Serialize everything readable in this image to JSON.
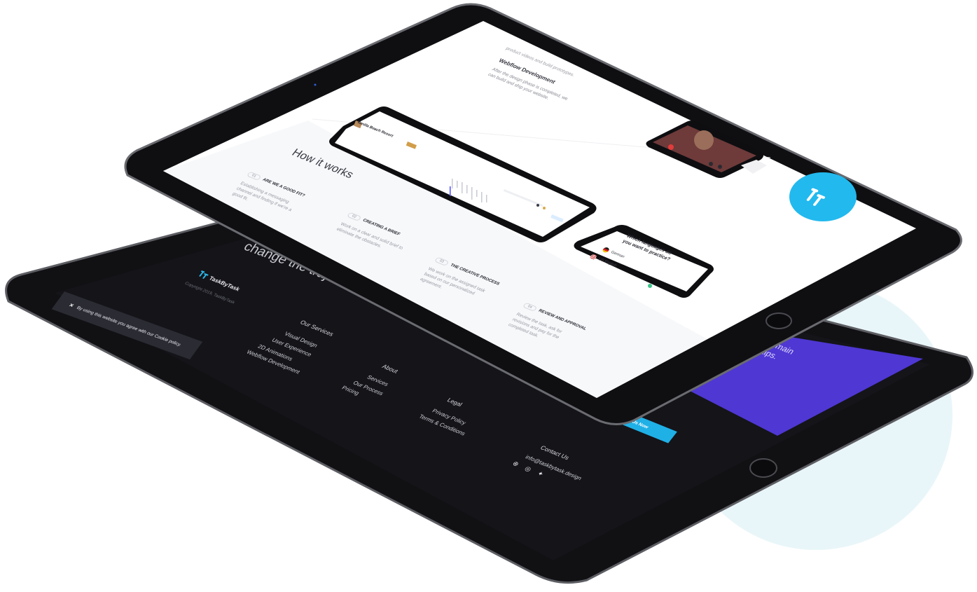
{
  "back": {
    "hero_line": "change the trajectory of your business.",
    "brand": "TaskByTask",
    "copyright": "Copyright 2019, TaskByTask",
    "cookie_text": "By using this website you agree with our Cookie policy.",
    "cookie_close": "×",
    "services": {
      "heading": "Our Services",
      "items": [
        "Visual Design",
        "User Experience",
        "2D Animations",
        "Webflow Development"
      ]
    },
    "about": {
      "heading": "About",
      "items": [
        "Services",
        "Our Process",
        "Pricing"
      ]
    },
    "legal": {
      "heading": "Legal",
      "items": [
        "Privacy Policy",
        "Terms & Conditions"
      ]
    },
    "contact": {
      "heading": "Contact Us",
      "email": "info@taskbytask.design"
    },
    "cta_label": "Us Now",
    "purple_line1": "ur main",
    "purple_line2": "hips.",
    "colors": {
      "accent": "#1fb0e6",
      "purple": "#4e37d3",
      "dark": "#141419"
    },
    "social_icons": [
      "dribbble-icon",
      "instagram-icon",
      "twitter-icon"
    ]
  },
  "front": {
    "top_desc": "product videos and build prototypes.",
    "webflow_title": "Webflow Development",
    "webflow_desc": "After the design phase is completed, we can build and ship your website.",
    "how_title": "How it works",
    "steps": [
      {
        "num": "01",
        "title": "ARE WE A GOOD FIT?",
        "text": "Establishing a messaging channel and finding if we're a good fit."
      },
      {
        "num": "02",
        "title": "CREATING A BRIEF",
        "text": "Work on a clear and solid brief to eliminate the obstacles."
      },
      {
        "num": "03",
        "title": "THE CREATIVE PROCESS",
        "text": "We work on the assigned task based on our personalized agreement."
      },
      {
        "num": "04",
        "title": "REVIEW AND APPROVAL",
        "text": "Review the task, ask for revisions and pay for the completed task."
      }
    ],
    "phone_a_title": "Vanilla Beach Resort",
    "language_question": "Which languages do you want to practice?",
    "languages": [
      {
        "name": "German",
        "color": "#d9a400"
      },
      {
        "name": "US English",
        "color": "#3b5bb5"
      }
    ],
    "colors": {
      "fab": "#22b9ee",
      "screen": "#ffffff",
      "section_bg": "#f7f8fa"
    }
  }
}
